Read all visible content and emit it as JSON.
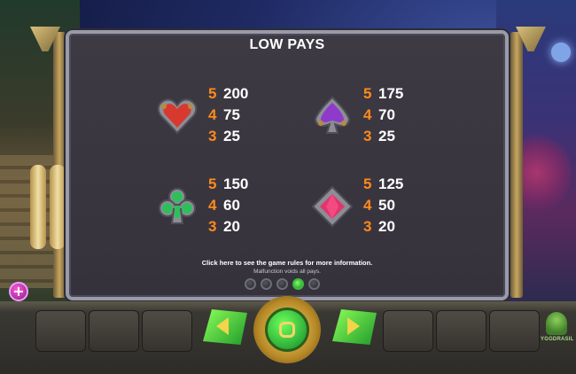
{
  "paytable": {
    "title": "LOW PAYS",
    "groups": [
      {
        "symbol": "heart-icon",
        "pays": [
          {
            "count": "5",
            "amount": "200"
          },
          {
            "count": "4",
            "amount": "75"
          },
          {
            "count": "3",
            "amount": "25"
          }
        ]
      },
      {
        "symbol": "spade-icon",
        "pays": [
          {
            "count": "5",
            "amount": "175"
          },
          {
            "count": "4",
            "amount": "70"
          },
          {
            "count": "3",
            "amount": "25"
          }
        ]
      },
      {
        "symbol": "club-icon",
        "pays": [
          {
            "count": "5",
            "amount": "150"
          },
          {
            "count": "4",
            "amount": "60"
          },
          {
            "count": "3",
            "amount": "20"
          }
        ]
      },
      {
        "symbol": "diamond-icon",
        "pays": [
          {
            "count": "5",
            "amount": "125"
          },
          {
            "count": "4",
            "amount": "50"
          },
          {
            "count": "3",
            "amount": "20"
          }
        ]
      }
    ],
    "info_link": "Click here to see the game rules for more information.",
    "note": "Malfunction voids all pays.",
    "pages": 5,
    "active_page": 4
  },
  "branding": {
    "logo_text": "YGGDRASIL"
  },
  "colors": {
    "pay_count": "#ff8a1c",
    "pay_amount": "#ffffff",
    "accent_green": "#2fbf3a"
  }
}
